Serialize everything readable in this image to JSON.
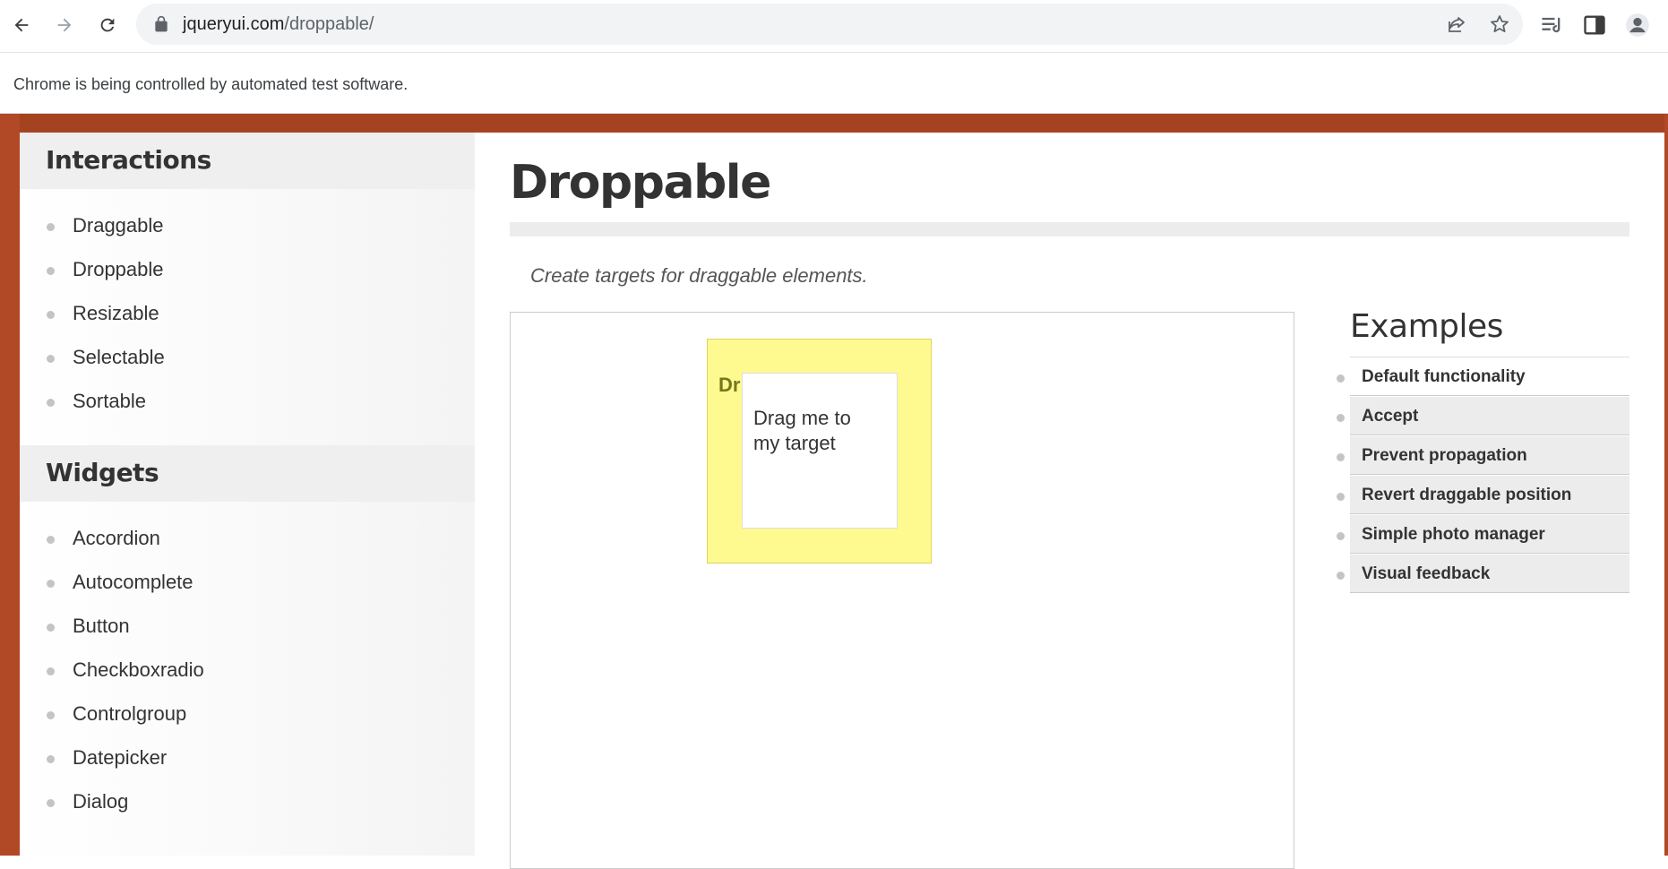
{
  "browser": {
    "url_host": "jqueryui.com",
    "url_path": "/droppable/",
    "infobar_text": "Chrome is being controlled by automated test software."
  },
  "sidebar": {
    "sections": [
      {
        "title": "Interactions",
        "items": [
          "Draggable",
          "Droppable",
          "Resizable",
          "Selectable",
          "Sortable"
        ]
      },
      {
        "title": "Widgets",
        "items": [
          "Accordion",
          "Autocomplete",
          "Button",
          "Checkboxradio",
          "Controlgroup",
          "Datepicker",
          "Dialog"
        ]
      }
    ]
  },
  "main": {
    "title": "Droppable",
    "subtitle": "Create targets for draggable elements.",
    "demo": {
      "droppable_text": "Dr",
      "draggable_text_line1": "Drag me to",
      "draggable_text_line2": "my target"
    },
    "examples": {
      "title": "Examples",
      "items": [
        "Default functionality",
        "Accept",
        "Prevent propagation",
        "Revert draggable position",
        "Simple photo manager",
        "Visual feedback"
      ]
    }
  },
  "colors": {
    "page_frame": "#b24926",
    "droppable_bg": "#fffa90",
    "droppable_text": "#777620"
  }
}
